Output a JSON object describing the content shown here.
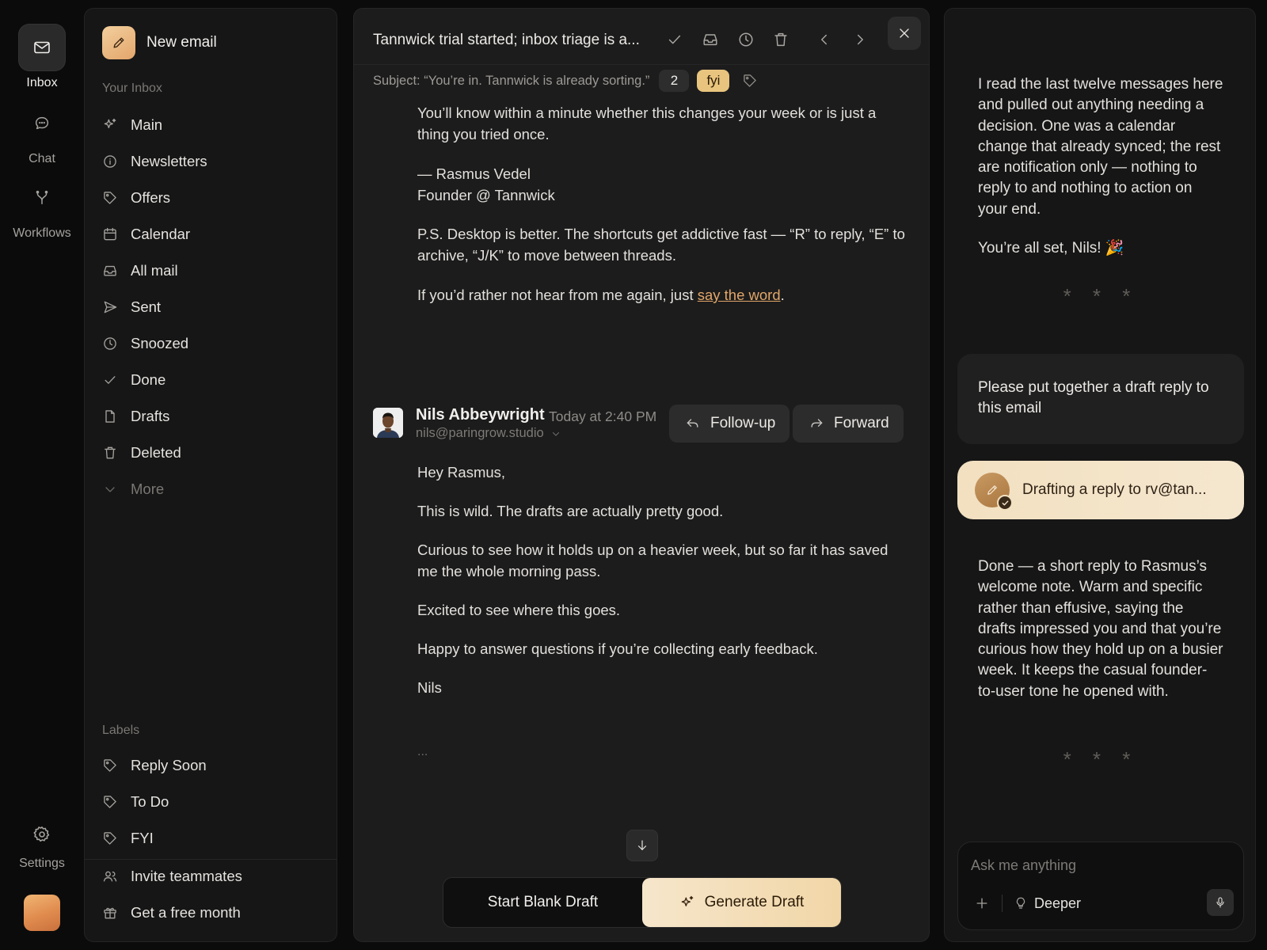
{
  "rail": {
    "items": [
      {
        "label": "Inbox",
        "icon": "envelope-icon"
      },
      {
        "label": "Chat",
        "icon": "chat-bubble-icon"
      },
      {
        "label": "Workflows",
        "icon": "branch-icon"
      },
      {
        "label": "Settings",
        "icon": "gear-icon"
      }
    ]
  },
  "sidebar": {
    "new_email": "New email",
    "inbox_title": "Your Inbox",
    "inbox_items": [
      {
        "label": "Main",
        "icon": "sparkle-icon"
      },
      {
        "label": "Newsletters",
        "icon": "info-icon"
      },
      {
        "label": "Offers",
        "icon": "tag-icon"
      },
      {
        "label": "Calendar",
        "icon": "calendar-icon"
      },
      {
        "label": "All mail",
        "icon": "tray-icon"
      },
      {
        "label": "Sent",
        "icon": "send-icon"
      },
      {
        "label": "Snoozed",
        "icon": "clock-icon"
      },
      {
        "label": "Done",
        "icon": "check-icon"
      },
      {
        "label": "Drafts",
        "icon": "document-icon"
      },
      {
        "label": "Deleted",
        "icon": "trash-icon"
      },
      {
        "label": "More",
        "icon": "chevron-down-icon"
      }
    ],
    "labels_title": "Labels",
    "labels": [
      {
        "label": "Reply Soon",
        "icon": "tag-icon"
      },
      {
        "label": "To Do",
        "icon": "tag-icon"
      },
      {
        "label": "FYI",
        "icon": "tag-icon"
      }
    ],
    "footer": [
      {
        "label": "Invite teammates",
        "icon": "users-icon"
      },
      {
        "label": "Get a free month",
        "icon": "gift-icon"
      }
    ]
  },
  "email": {
    "thread_title": "Tannwick trial started; inbox triage is a...",
    "subject": "Subject: “You’re in. Tannwick is already sorting.”",
    "count": "2",
    "badge": "fyi",
    "badge_color": "#e8c47e",
    "previous_body": {
      "p1": "You’ll know within a minute whether this changes your week or is just a thing you tried once.",
      "sig_line1": "— Rasmus Vedel",
      "sig_line2": "Founder @ Tannwick",
      "ps": "P.S. Desktop is better. The shortcuts get addictive fast — “R” to reply, “E” to archive, “J/K” to move between threads.",
      "unsub_prefix": "If you’d rather not hear from me again, just ",
      "unsub_link": "say the word",
      "unsub_suffix": "."
    },
    "message": {
      "sender_name": "Nils Abbeywright",
      "time": "Today at 2:40 PM",
      "sender_email": "nils@paringrow.studio",
      "followup_label": "Follow-up",
      "forward_label": "Forward",
      "body": [
        "Hey Rasmus,",
        "This is wild. The drafts are actually pretty good.",
        "Curious to see how it holds up on a heavier week, but so far it has saved me the whole morning pass.",
        "Excited to see where this goes.",
        "Happy to answer questions if you’re collecting early feedback.",
        "Nils"
      ],
      "ellipsis": "..."
    },
    "start_blank_draft": "Start Blank Draft",
    "generate_draft": "Generate Draft"
  },
  "assistant": {
    "reply1": "I read the last twelve messages here and pulled out anything needing a decision. One was a calendar change that already synced; the rest are notification only — nothing to reply to and nothing to action on your end.",
    "reply1_end": "You’re all set, Nils! 🎉",
    "separator": "* * *",
    "user_message": "Please put together a draft reply to this email",
    "drafting_label": "Drafting a reply to rv@tan...",
    "reply2": "Done — a short reply to Rasmus’s welcome note. Warm and specific rather than effusive, saying the drafts impressed you and that you’re curious how they hold up on a busier week. It keeps the casual founder-to-user tone he opened with.",
    "input_placeholder": "Ask me anything",
    "deeper_label": "Deeper",
    "accent_color": "#f2e0c0"
  }
}
